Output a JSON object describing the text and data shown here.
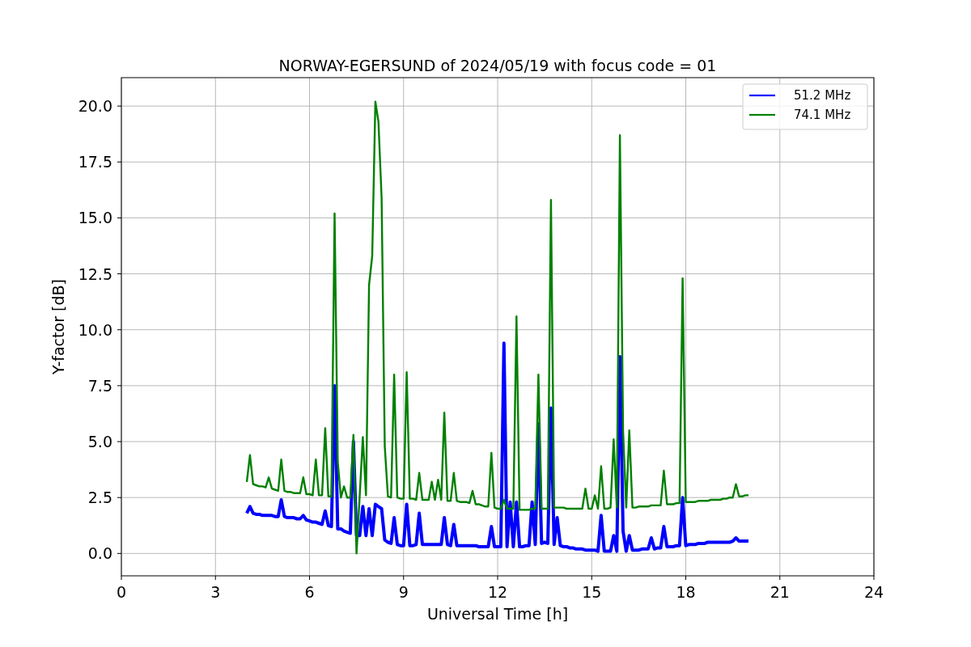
{
  "chart_data": {
    "type": "line",
    "title": "NORWAY-EGERSUND of 2024/05/19 with focus code = 01",
    "xlabel": "Universal Time [h]",
    "ylabel": "Y-factor [dB]",
    "x": [
      4.0,
      4.1,
      4.2,
      4.3,
      4.4,
      4.5,
      4.6,
      4.7,
      4.8,
      4.9,
      5.0,
      5.1,
      5.2,
      5.3,
      5.4,
      5.5,
      5.6,
      5.7,
      5.8,
      5.9,
      6.0,
      6.1,
      6.2,
      6.3,
      6.4,
      6.5,
      6.6,
      6.7,
      6.8,
      6.9,
      7.0,
      7.1,
      7.2,
      7.3,
      7.4,
      7.5,
      7.6,
      7.7,
      7.8,
      7.9,
      8.0,
      8.1,
      8.2,
      8.3,
      8.4,
      8.5,
      8.6,
      8.7,
      8.8,
      8.9,
      9.0,
      9.1,
      9.2,
      9.3,
      9.4,
      9.5,
      9.6,
      9.7,
      9.8,
      9.9,
      10.0,
      10.1,
      10.2,
      10.3,
      10.4,
      10.5,
      10.6,
      10.7,
      10.8,
      10.9,
      11.0,
      11.1,
      11.2,
      11.3,
      11.4,
      11.5,
      11.6,
      11.7,
      11.8,
      11.9,
      12.0,
      12.1,
      12.2,
      12.3,
      12.4,
      12.5,
      12.6,
      12.7,
      12.8,
      12.9,
      13.0,
      13.1,
      13.2,
      13.3,
      13.4,
      13.5,
      13.6,
      13.7,
      13.8,
      13.9,
      14.0,
      14.1,
      14.2,
      14.3,
      14.4,
      14.5,
      14.6,
      14.7,
      14.8,
      14.9,
      15.0,
      15.1,
      15.2,
      15.3,
      15.4,
      15.5,
      15.6,
      15.7,
      15.8,
      15.9,
      16.0,
      16.1,
      16.2,
      16.3,
      16.4,
      16.5,
      16.6,
      16.7,
      16.8,
      16.9,
      17.0,
      17.1,
      17.2,
      17.3,
      17.4,
      17.5,
      17.6,
      17.7,
      17.8,
      17.9,
      18.0,
      18.1,
      18.2,
      18.3,
      18.4,
      18.5,
      18.6,
      18.7,
      18.8,
      18.9,
      19.0,
      19.1,
      19.2,
      19.3,
      19.4,
      19.5,
      19.6,
      19.7,
      19.8,
      19.9,
      20.0
    ],
    "series": [
      {
        "name": "51.2 MHz",
        "color": "#0000ff",
        "values": [
          1.8,
          2.1,
          1.8,
          1.75,
          1.75,
          1.7,
          1.7,
          1.7,
          1.7,
          1.65,
          1.65,
          2.4,
          1.65,
          1.6,
          1.6,
          1.6,
          1.55,
          1.55,
          1.7,
          1.5,
          1.45,
          1.4,
          1.4,
          1.35,
          1.3,
          1.9,
          1.25,
          1.2,
          7.5,
          1.1,
          1.1,
          1.0,
          0.95,
          0.9,
          5.0,
          0.8,
          0.8,
          2.1,
          0.8,
          2.0,
          0.8,
          2.2,
          2.1,
          2.0,
          0.6,
          0.5,
          0.45,
          1.6,
          0.4,
          0.35,
          0.35,
          2.2,
          0.35,
          0.35,
          0.4,
          1.8,
          0.4,
          0.4,
          0.4,
          0.4,
          0.4,
          0.4,
          0.4,
          1.6,
          0.4,
          0.35,
          1.3,
          0.35,
          0.35,
          0.35,
          0.35,
          0.35,
          0.35,
          0.35,
          0.3,
          0.3,
          0.3,
          0.3,
          1.2,
          0.3,
          0.3,
          0.3,
          9.4,
          0.3,
          2.3,
          0.3,
          2.3,
          0.3,
          0.3,
          0.35,
          0.35,
          2.3,
          0.4,
          5.8,
          0.45,
          0.5,
          0.45,
          6.5,
          0.4,
          1.6,
          0.35,
          0.3,
          0.3,
          0.25,
          0.25,
          0.2,
          0.2,
          0.2,
          0.15,
          0.15,
          0.15,
          0.15,
          0.1,
          1.7,
          0.1,
          0.1,
          0.1,
          0.8,
          0.1,
          8.8,
          1.0,
          0.1,
          0.8,
          0.15,
          0.15,
          0.15,
          0.2,
          0.2,
          0.2,
          0.7,
          0.2,
          0.25,
          0.25,
          1.2,
          0.3,
          0.3,
          0.3,
          0.35,
          0.35,
          2.5,
          0.35,
          0.4,
          0.4,
          0.4,
          0.45,
          0.45,
          0.45,
          0.5,
          0.5,
          0.5,
          0.5,
          0.5,
          0.5,
          0.5,
          0.5,
          0.55,
          0.7,
          0.55,
          0.55,
          0.55,
          0.55
        ]
      },
      {
        "name": "74.1 MHz",
        "color": "#008000",
        "values": [
          3.2,
          4.4,
          3.1,
          3.05,
          3.0,
          3.0,
          2.95,
          3.4,
          2.9,
          2.85,
          2.8,
          4.2,
          2.8,
          2.75,
          2.75,
          2.7,
          2.7,
          2.7,
          3.4,
          2.65,
          2.65,
          2.6,
          4.2,
          2.6,
          2.6,
          5.6,
          2.55,
          2.55,
          15.2,
          4.1,
          2.5,
          3.0,
          2.5,
          2.5,
          5.3,
          0.0,
          2.55,
          5.2,
          2.6,
          12.0,
          13.3,
          20.2,
          19.3,
          15.9,
          4.8,
          2.55,
          2.5,
          8.0,
          2.5,
          2.45,
          2.45,
          8.1,
          2.45,
          2.45,
          2.4,
          3.6,
          2.4,
          2.4,
          2.4,
          3.2,
          2.4,
          3.3,
          2.4,
          6.3,
          2.35,
          2.35,
          3.6,
          2.35,
          2.3,
          2.3,
          2.3,
          2.25,
          2.8,
          2.2,
          2.2,
          2.15,
          2.1,
          2.1,
          4.5,
          2.05,
          2.0,
          2.0,
          2.4,
          2.0,
          2.0,
          2.0,
          10.6,
          1.95,
          1.95,
          1.95,
          1.95,
          2.0,
          2.0,
          8.0,
          2.0,
          2.0,
          2.0,
          15.8,
          2.05,
          2.05,
          2.05,
          2.05,
          2.0,
          2.0,
          2.0,
          2.0,
          2.0,
          2.0,
          2.9,
          2.0,
          2.0,
          2.6,
          2.0,
          3.9,
          2.0,
          2.0,
          2.05,
          5.1,
          2.05,
          18.7,
          5.5,
          2.05,
          5.5,
          2.05,
          2.05,
          2.1,
          2.1,
          2.1,
          2.1,
          2.15,
          2.15,
          2.15,
          2.15,
          3.7,
          2.2,
          2.2,
          2.2,
          2.25,
          2.25,
          12.3,
          2.3,
          2.3,
          2.3,
          2.3,
          2.35,
          2.35,
          2.35,
          2.35,
          2.4,
          2.4,
          2.4,
          2.4,
          2.45,
          2.45,
          2.5,
          2.5,
          3.1,
          2.55,
          2.55,
          2.6,
          2.6
        ]
      }
    ],
    "grid": true,
    "legend": true,
    "xlim": [
      0,
      24
    ],
    "ylim": [
      -1.0,
      21.27
    ],
    "xticks": [
      0,
      3,
      6,
      9,
      12,
      15,
      18,
      21,
      24
    ],
    "yticks": [
      {
        "value": 0,
        "label": "0.0"
      },
      {
        "value": 2.5,
        "label": "2.5"
      },
      {
        "value": 5,
        "label": "5.0"
      },
      {
        "value": 7.5,
        "label": "7.5"
      },
      {
        "value": 10,
        "label": "10.0"
      },
      {
        "value": 12.5,
        "label": "12.5"
      },
      {
        "value": 15,
        "label": "15.0"
      },
      {
        "value": 17.5,
        "label": "17.5"
      },
      {
        "value": 20,
        "label": "20.0"
      }
    ]
  }
}
